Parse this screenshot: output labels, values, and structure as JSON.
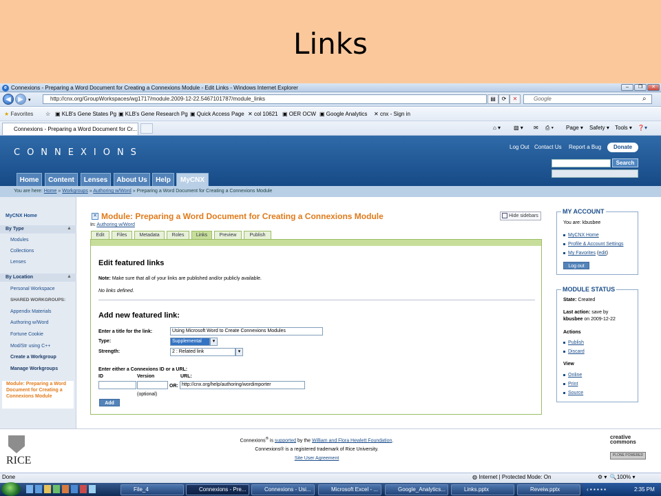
{
  "slide": {
    "title": "Links"
  },
  "browser": {
    "window_title": "Connexions - Preparing a Word Document for Creating a Connexions Module - Edit Links - Windows Internet Explorer",
    "address": "http://cnx.org/GroupWorkspaces/wg1717/module.2009-12-22.5467101787/module_links",
    "search_placeholder": "Google",
    "favorites_label": "Favorites",
    "favorites": [
      "KLB's Gene States Pg",
      "KLB's Gene Research Pg",
      "Quick Access Page",
      "col 10621",
      "OER OCW",
      "Google Analytics",
      "cnx - Sign in"
    ],
    "tab_title": "Connexions - Preparing a Word Document for Cr...",
    "commands": [
      "Page",
      "Safety",
      "Tools"
    ],
    "status_left": "Done",
    "status_zone": "Internet | Protected Mode: On",
    "zoom": "100%"
  },
  "cnx": {
    "logo": "CONNEXIONS",
    "top_links": [
      "Log Out",
      "Contact Us",
      "Report a Bug"
    ],
    "donate": "Donate",
    "search_button": "Search",
    "nav_tabs": [
      "Home",
      "Content",
      "Lenses",
      "About Us",
      "Help",
      "MyCNX"
    ],
    "breadcrumb": {
      "prefix": "You are here:",
      "items": [
        "Home",
        "Workgroups",
        "Authoring w/Word"
      ],
      "current": "Preparing a Word Document for Creating a Connexions Module"
    }
  },
  "sidebar": {
    "home": "MyCNX Home",
    "by_type": "By Type",
    "type_items": [
      "Modules",
      "Collections",
      "Lenses"
    ],
    "by_location": "By Location",
    "personal": "Personal Workspace",
    "shared_heading": "SHARED WORKGROUPS:",
    "workgroups": [
      "Appendix Materials",
      "Authoring w/Word",
      "Fortune Cookie",
      "Mod/Str using C++"
    ],
    "create": "Create a Workgroup",
    "manage": "Manage Workgroups",
    "active_module": "Module: Preparing a Word Document for Creating a Connexions Module"
  },
  "main": {
    "title": "Module: Preparing a Word Document for Creating a Connexions Module",
    "hide_sidebars": "Hide sidebars",
    "in_label": "In:",
    "in_link": "Authoring w/Word",
    "tabs": [
      "Edit",
      "Files",
      "Metadata",
      "Roles",
      "Links",
      "Preview",
      "Publish"
    ],
    "active_tab": "Links",
    "featured_heading": "Edit featured links",
    "note_label": "Note:",
    "note_text": "Make sure that all of your links are published and/or publicly available.",
    "no_links": "No links defined.",
    "add_heading": "Add new featured link:",
    "title_label": "Enter a title for the link:",
    "title_value": "Using Microsoft Word to Create Connexions Modules",
    "type_label": "Type:",
    "type_value": "Supplemental",
    "strength_label": "Strength:",
    "strength_value": "2 : Related link",
    "either_label": "Enter either a Connexions ID or a URL:",
    "id_label": "ID",
    "version_label": "Version",
    "url_label": "URL:",
    "or_label": "OR:",
    "url_value": "http://cnx.org/help/authoring/wordimporter",
    "optional": "(optional)",
    "add_button": "Add"
  },
  "account": {
    "title": "MY ACCOUNT",
    "user_line": "You are: kbusbee",
    "links": [
      "MyCNX Home",
      "Profile & Account Settings",
      "My Favorites"
    ],
    "edit": "edit",
    "logout": "Log out"
  },
  "status": {
    "title": "MODULE STATUS",
    "state_label": "State:",
    "state_value": "Created",
    "last_action_label": "Last action:",
    "last_action_value": "save by",
    "last_action_user": "kbusbee",
    "last_action_date": "on 2009-12-22",
    "actions_heading": "Actions",
    "actions": [
      "Publish",
      "Discard"
    ],
    "view_heading": "View",
    "view": [
      "Online",
      "Print",
      "Source"
    ]
  },
  "footer": {
    "line1_prefix": "Connexions",
    "line1_is": "is",
    "line1_supported": "supported",
    "line1_rest": "by the",
    "line1_foundation": "William and Flora Hewlett Foundation",
    "line2": "Connexions® is a registered trademark of Rice University.",
    "agreement": "Site User Agreement",
    "rice": "RICE",
    "cc": "creative commons"
  },
  "taskbar": {
    "buttons": [
      "File_4",
      "Connexions - Pre...",
      "Connexions - Usi...",
      "Microsoft Excel - ...",
      "Google_Analytics...",
      "Links.pptx",
      "Reveiw.pptx"
    ],
    "active": "Connexions - Pre...",
    "clock": "2:35 PM"
  },
  "colors": {
    "slide_bg": "#fbc89c",
    "cnx_blue": "#164a86",
    "module_orange": "#e07a1a",
    "tab_green": "#c7de9b"
  }
}
